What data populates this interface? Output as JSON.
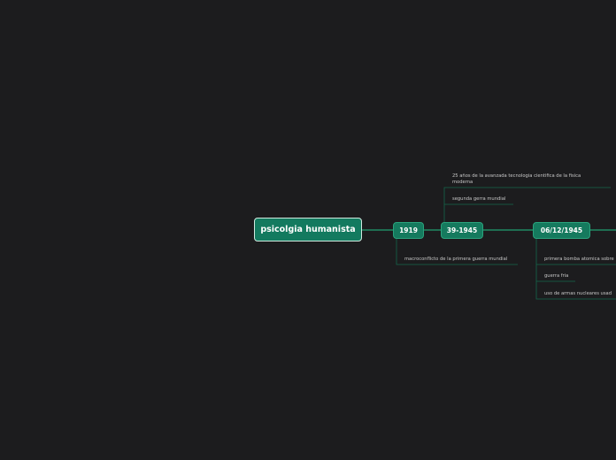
{
  "root": {
    "label": "psicolgia humanista"
  },
  "timeline": [
    {
      "label": "1919",
      "notes": [
        "macroconflicto de la primera guerra mundial"
      ]
    },
    {
      "label": "39-1945",
      "notes": [
        "25 años de la avanzada tecnologia cientifica de la fisica",
        "moderna",
        "segunda gerra mundial"
      ]
    },
    {
      "label": "06/12/1945",
      "notes": [
        "primera bomba atomica sobre",
        "guerra fria",
        "uso de armas nucleares usad"
      ]
    }
  ],
  "colors": {
    "background": "#1c1c1e",
    "node_fill": "#137a5f",
    "connector": "#1fa070",
    "leaf_line": "#15664c"
  }
}
